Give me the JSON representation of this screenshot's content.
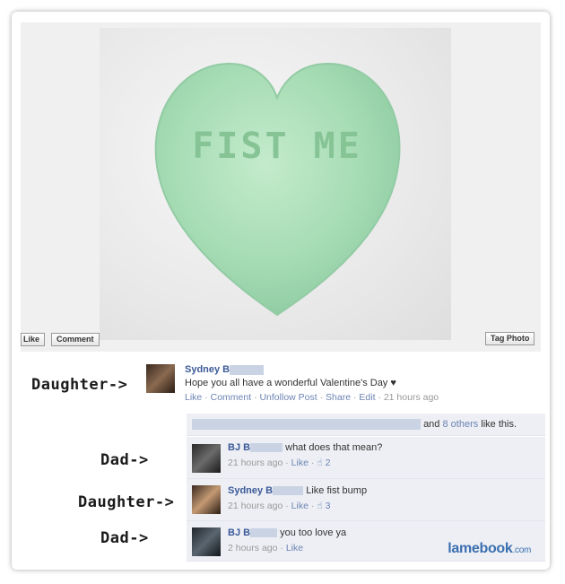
{
  "photo": {
    "candy_text": "FIST ME",
    "like_label": "Like",
    "comment_label": "Comment",
    "tag_label": "Tag Photo"
  },
  "callouts": {
    "c1": "Daughter->",
    "c2": "Dad->",
    "c3": "Daughter->",
    "c4": "Dad->"
  },
  "post": {
    "author": "Sydney B",
    "text": "Hope you all have a wonderful Valentine's Day ♥",
    "actions": [
      "Like",
      "Comment",
      "Unfollow Post",
      "Share",
      "Edit"
    ],
    "time": "21 hours ago"
  },
  "likes": {
    "suffix_and": "and",
    "others": "8 others",
    "suffix_tail": "like this."
  },
  "comments": [
    {
      "author": "BJ B",
      "text": "what does that mean?",
      "time": "21 hours ago",
      "like": "Like",
      "likes_count": "2"
    },
    {
      "author": "Sydney B",
      "text": "Like fist bump",
      "time": "21 hours ago",
      "like": "Like",
      "likes_count": "3"
    },
    {
      "author": "BJ B",
      "text": "you too love ya",
      "time": "2 hours ago",
      "like": "Like"
    }
  ],
  "watermark": {
    "brand": "lamebook",
    "tld": ".com"
  },
  "colors": {
    "candy": "#a8dcb8",
    "link": "#3b5998",
    "comment_bg": "#edeff4"
  }
}
